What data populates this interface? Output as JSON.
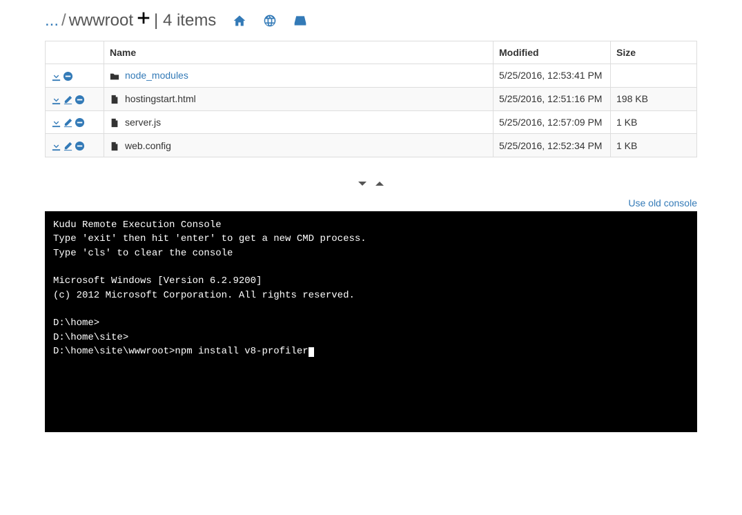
{
  "breadcrumb": {
    "ellipsis": "...",
    "sep1": "/",
    "current": "wwwroot",
    "items_label": "| 4 items"
  },
  "table": {
    "headers": {
      "name": "Name",
      "modified": "Modified",
      "size": "Size"
    },
    "rows": [
      {
        "type": "folder",
        "name": "node_modules",
        "modified": "5/25/2016, 12:53:41 PM",
        "size": ""
      },
      {
        "type": "file",
        "name": "hostingstart.html",
        "modified": "5/25/2016, 12:51:16 PM",
        "size": "198 KB"
      },
      {
        "type": "file",
        "name": "server.js",
        "modified": "5/25/2016, 12:57:09 PM",
        "size": "1 KB"
      },
      {
        "type": "file",
        "name": "web.config",
        "modified": "5/25/2016, 12:52:34 PM",
        "size": "1 KB"
      }
    ]
  },
  "console_link": "Use old console",
  "console": {
    "lines": [
      "Kudu Remote Execution Console",
      "Type 'exit' then hit 'enter' to get a new CMD process.",
      "Type 'cls' to clear the console",
      "",
      "Microsoft Windows [Version 6.2.9200]",
      "(c) 2012 Microsoft Corporation. All rights reserved.",
      "",
      "D:\\home>",
      "D:\\home\\site>"
    ],
    "prompt": "D:\\home\\site\\wwwroot>",
    "input": "npm install v8-profiler"
  }
}
